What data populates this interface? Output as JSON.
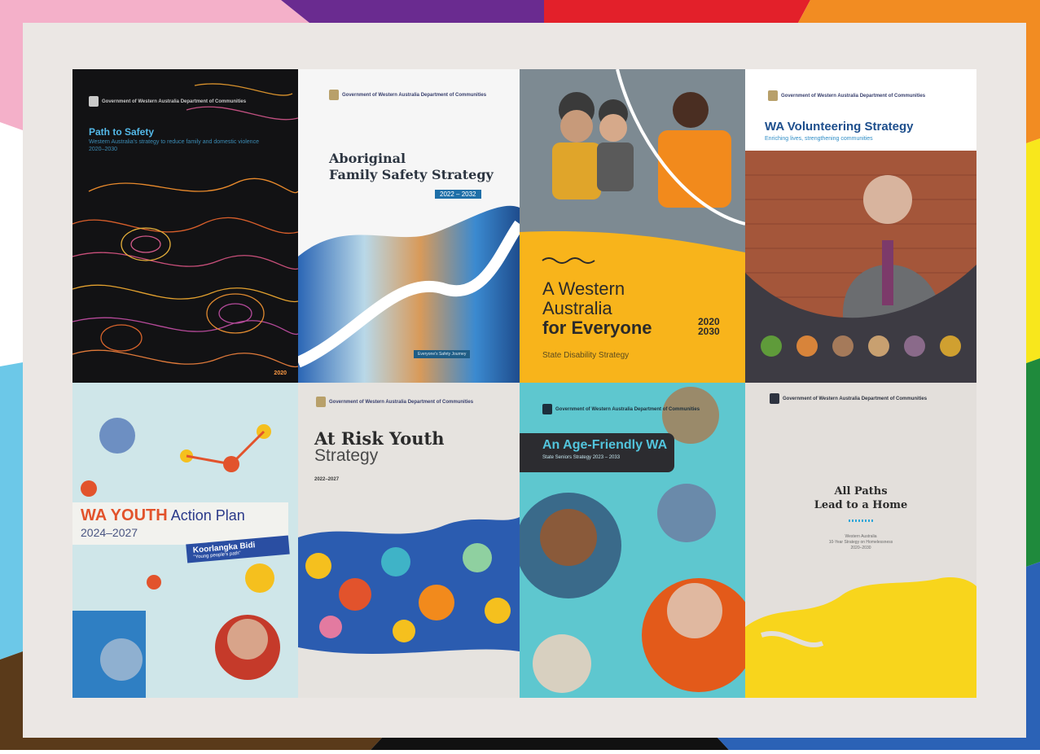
{
  "colors": {
    "mat": "#ebe7e4",
    "stripe_pink": "#f4b0c9",
    "stripe_purple": "#6a2b90",
    "stripe_red": "#e3202a",
    "stripe_orange": "#f28c22",
    "stripe_yellow": "#f8e71c",
    "stripe_green": "#1f8a3c",
    "stripe_blue": "#2b62b6",
    "stripe_lightblue": "#6cc8e8",
    "stripe_brown": "#5a3a1a",
    "stripe_black": "#111111"
  },
  "covers": [
    {
      "id": "path-to-safety",
      "gov": "Government of Western Australia Department of Communities",
      "title": "Path to Safety",
      "subtitle": "Western Australia's strategy to reduce family and domestic violence 2020–2030",
      "year": "2020"
    },
    {
      "id": "aboriginal-family-safety",
      "gov": "Government of Western Australia Department of Communities",
      "title_line1": "Aboriginal",
      "title_line2": "Family Safety Strategy",
      "years": "2022 – 2032",
      "footer": "Everyone's Safety Journey"
    },
    {
      "id": "wa-for-everyone",
      "title_line1": "A Western",
      "title_line2": "Australia",
      "title_line3": "for Everyone",
      "year_start": "2020",
      "year_end": "2030",
      "subtitle": "State Disability Strategy"
    },
    {
      "id": "wa-volunteering",
      "gov": "Government of Western Australia Department of Communities",
      "title": "WA Volunteering Strategy",
      "subtitle": "Enriching lives, strengthening communities"
    },
    {
      "id": "wa-youth",
      "title_wa_youth": "WA YOUTH",
      "title_action_plan": "Action Plan",
      "years": "2024–2027",
      "tag_main": "Koorlangka Bidi",
      "tag_sub": "\"Young people's path\""
    },
    {
      "id": "at-risk-youth",
      "gov": "Government of Western Australia Department of Communities",
      "title_line1": "At Risk Youth",
      "title_line2": "Strategy",
      "years": "2022–2027"
    },
    {
      "id": "age-friendly-wa",
      "gov": "Government of Western Australia Department of Communities",
      "title": "An Age-Friendly WA",
      "subtitle": "State Seniors Strategy 2023 – 2033"
    },
    {
      "id": "all-paths",
      "gov": "Government of Western Australia Department of Communities",
      "title_line1": "All Paths",
      "title_line2": "Lead to a Home",
      "sub_line1": "Western Australia",
      "sub_line2": "10-Year Strategy on Homelessness",
      "sub_line3": "2020–2030"
    }
  ]
}
